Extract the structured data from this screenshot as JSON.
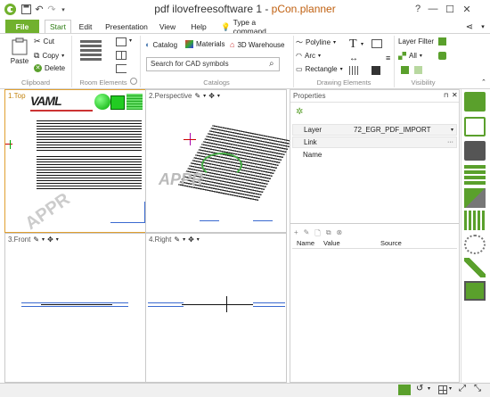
{
  "window": {
    "title_main": "pdf ilovefreesoftware 1 - ",
    "title_app": "pCon.planner",
    "command": "Type a command"
  },
  "tabs": [
    "File",
    "Start",
    "Edit",
    "Presentation",
    "View",
    "Help"
  ],
  "ribbon": {
    "clipboard": {
      "paste": "Paste",
      "cut": "Cut",
      "copy": "Copy",
      "delete": "Delete",
      "group": "Clipboard"
    },
    "room_elements": {
      "group": "Room Elements"
    },
    "catalogs": {
      "catalog": "Catalog",
      "materials": "Materials",
      "warehouse": "3D Warehouse",
      "search_placeholder": "Search for CAD symbols",
      "group": "Catalogs"
    },
    "drawing": {
      "polyline": "Polyline",
      "arc": "Arc",
      "rectangle": "Rectangle",
      "group": "Drawing Elements"
    },
    "visibility": {
      "layer_filter": "Layer Filter",
      "all": "All",
      "group": "Visibility"
    }
  },
  "viewports": [
    {
      "label": "1.Top"
    },
    {
      "label": "2.Perspective"
    },
    {
      "label": "3.Front"
    },
    {
      "label": "4.Right"
    }
  ],
  "properties": {
    "title": "Properties",
    "rows": [
      {
        "label": "Layer",
        "value": "72_EGR_PDF_IMPORT"
      },
      {
        "label": "Link",
        "value": ""
      },
      {
        "label": "Name",
        "value": ""
      }
    ],
    "columns": [
      "Name",
      "Value",
      "Source"
    ]
  },
  "logo_text": "VAML",
  "watermark": "APPR",
  "colors": {
    "file_tab": "#71b12e",
    "accent": "#c06010",
    "green_icon": "#5aa02c"
  }
}
